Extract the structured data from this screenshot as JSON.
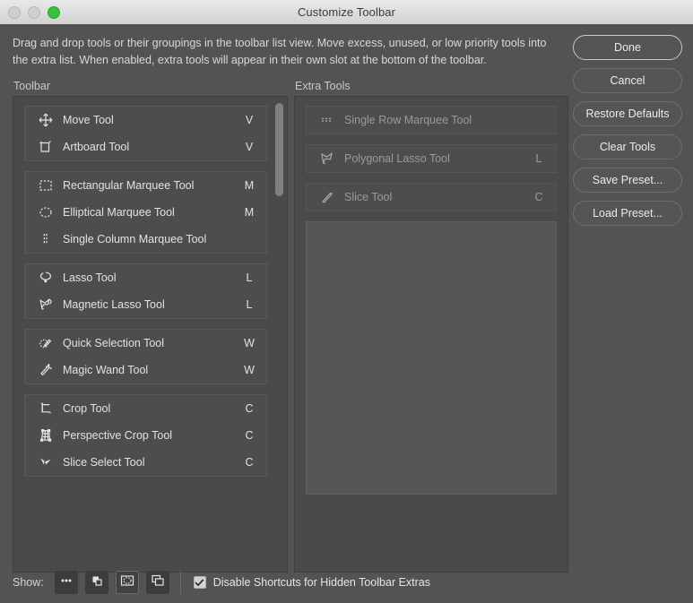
{
  "window": {
    "title": "Customize Toolbar",
    "traffic_lights": [
      "close-button",
      "minimize-button",
      "zoom-button"
    ]
  },
  "intro_text": "Drag and drop tools or their groupings in the toolbar list view. Move excess, unused, or low priority tools into the extra list. When enabled, extra tools will appear in their own slot at the bottom of the toolbar.",
  "columns": {
    "toolbar_header": "Toolbar",
    "extra_header": "Extra Tools"
  },
  "toolbar_groups": [
    {
      "tools": [
        {
          "name": "Move Tool",
          "shortcut": "V",
          "icon": "move-tool-icon"
        },
        {
          "name": "Artboard Tool",
          "shortcut": "V",
          "icon": "artboard-tool-icon"
        }
      ]
    },
    {
      "tools": [
        {
          "name": "Rectangular Marquee Tool",
          "shortcut": "M",
          "icon": "rectangular-marquee-tool-icon"
        },
        {
          "name": "Elliptical Marquee Tool",
          "shortcut": "M",
          "icon": "elliptical-marquee-tool-icon"
        },
        {
          "name": "Single Column Marquee Tool",
          "shortcut": "",
          "icon": "single-column-marquee-tool-icon"
        }
      ]
    },
    {
      "tools": [
        {
          "name": "Lasso Tool",
          "shortcut": "L",
          "icon": "lasso-tool-icon"
        },
        {
          "name": "Magnetic Lasso Tool",
          "shortcut": "L",
          "icon": "magnetic-lasso-tool-icon"
        }
      ]
    },
    {
      "tools": [
        {
          "name": "Quick Selection Tool",
          "shortcut": "W",
          "icon": "quick-selection-tool-icon"
        },
        {
          "name": "Magic Wand Tool",
          "shortcut": "W",
          "icon": "magic-wand-tool-icon"
        }
      ]
    },
    {
      "tools": [
        {
          "name": "Crop Tool",
          "shortcut": "C",
          "icon": "crop-tool-icon"
        },
        {
          "name": "Perspective Crop Tool",
          "shortcut": "C",
          "icon": "perspective-crop-tool-icon"
        },
        {
          "name": "Slice Select Tool",
          "shortcut": "C",
          "icon": "slice-select-tool-icon"
        }
      ]
    }
  ],
  "extra_groups": [
    {
      "tools": [
        {
          "name": "Single Row Marquee Tool",
          "shortcut": "",
          "icon": "single-row-marquee-tool-icon"
        }
      ]
    },
    {
      "tools": [
        {
          "name": "Polygonal Lasso Tool",
          "shortcut": "L",
          "icon": "polygonal-lasso-tool-icon"
        }
      ]
    },
    {
      "tools": [
        {
          "name": "Slice Tool",
          "shortcut": "C",
          "icon": "slice-tool-icon"
        }
      ]
    }
  ],
  "buttons": [
    {
      "label": "Done",
      "primary": true
    },
    {
      "label": "Cancel",
      "primary": false
    },
    {
      "label": "Restore Defaults",
      "primary": false
    },
    {
      "label": "Clear Tools",
      "primary": false
    },
    {
      "label": "Save Preset...",
      "primary": false
    },
    {
      "label": "Load Preset...",
      "primary": false
    }
  ],
  "bottom": {
    "show_label": "Show:",
    "icon_buttons": [
      {
        "icon": "ellipsis-icon",
        "selected": false
      },
      {
        "icon": "foreground-background-color-icon",
        "selected": false
      },
      {
        "icon": "quick-mask-icon",
        "selected": true
      },
      {
        "icon": "screen-mode-icon",
        "selected": false
      }
    ],
    "checkbox": {
      "label": "Disable Shortcuts for Hidden Toolbar Extras",
      "checked": true
    }
  },
  "colors": {
    "window_bg": "#535353",
    "panel_bg": "#4a4a4a",
    "group_bg": "#4d4d4d",
    "dropzone_bg": "#565656",
    "text": "#e2e2e2",
    "dim_text": "#9a9a9a",
    "titlebar": "#e0e0e0",
    "zoom_light": "#38c13c"
  }
}
